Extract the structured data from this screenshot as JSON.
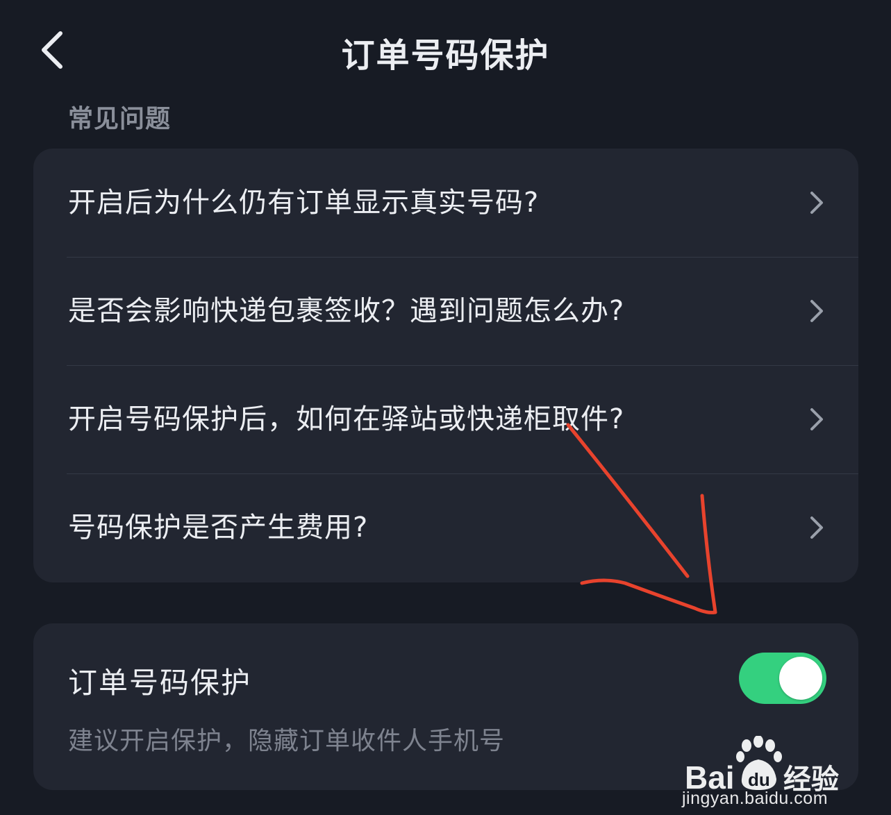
{
  "header": {
    "title": "订单号码保护",
    "back_icon": "chevron-left-icon"
  },
  "faq": {
    "section_label": "常见问题",
    "items": [
      {
        "label": "开启后为什么仍有订单显示真实号码?"
      },
      {
        "label": "是否会影响快递包裹签收？遇到问题怎么办?"
      },
      {
        "label": "开启号码保护后，如何在驿站或快递柜取件?"
      },
      {
        "label": "号码保护是否产生费用?"
      }
    ],
    "chevron_icon": "chevron-right-icon"
  },
  "protection": {
    "title": "订单号码保护",
    "description": "建议开启保护，隐藏订单收件人手机号",
    "enabled": true
  },
  "watermark": {
    "logo_text": "Bai du 经验",
    "url": "jingyan.baidu.com"
  },
  "colors": {
    "background": "#171b24",
    "card": "#222631",
    "switch_on": "#34d07f",
    "annotation_arrow": "#e8432d"
  }
}
